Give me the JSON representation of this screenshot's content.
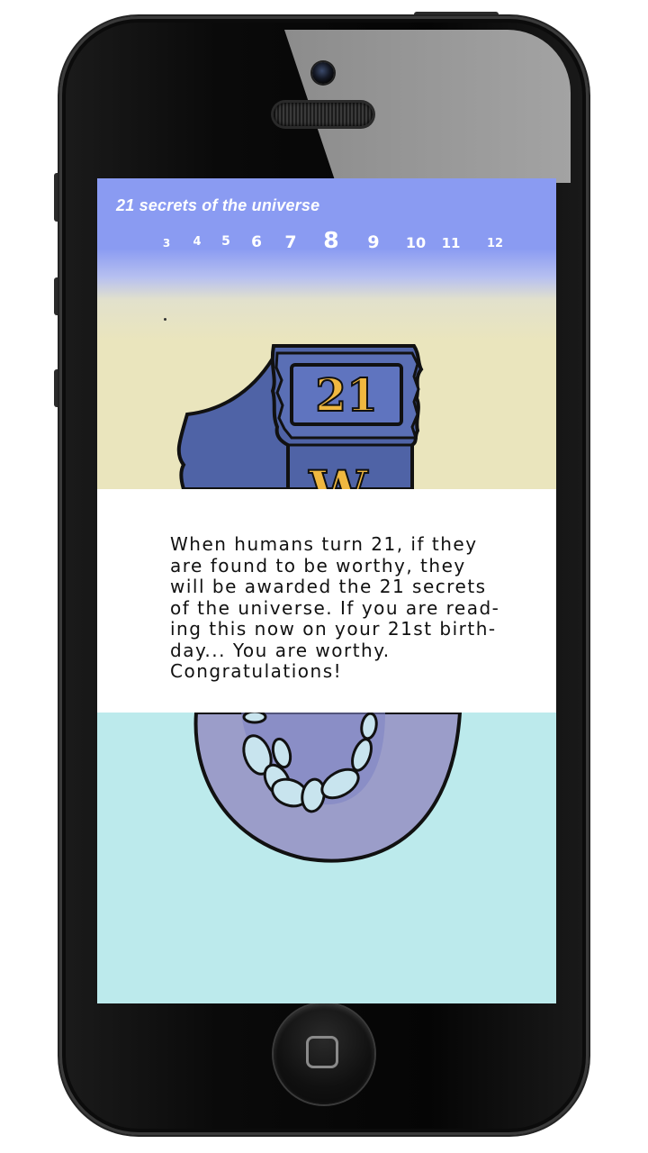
{
  "app": {
    "title": "21 secrets of the universe"
  },
  "nav": {
    "pages": [
      "3",
      "4",
      "5",
      "6",
      "7",
      "8",
      "9",
      "10",
      "11",
      "12"
    ],
    "current": "8"
  },
  "illustration": {
    "badge_text": "21",
    "letter": "W"
  },
  "content": {
    "lines": [
      "When humans turn 21, if they",
      "are found to be worthy, they",
      "will be awarded the 21 secrets",
      "of the universe. If you are read-",
      "ing this now on your 21st birth-",
      "day... You are worthy.",
      "Congratulations!"
    ]
  },
  "colors": {
    "header_blue": "#8a9bf2",
    "sand": "#eae5bd",
    "aqua": "#bceaec",
    "shield_blue": "#4f63a6",
    "ring_purple": "#9b9dc9",
    "gold": "#f0b840"
  },
  "icons": {
    "home_button": "home-square-icon",
    "camera": "camera-icon",
    "speaker": "speaker-icon"
  }
}
